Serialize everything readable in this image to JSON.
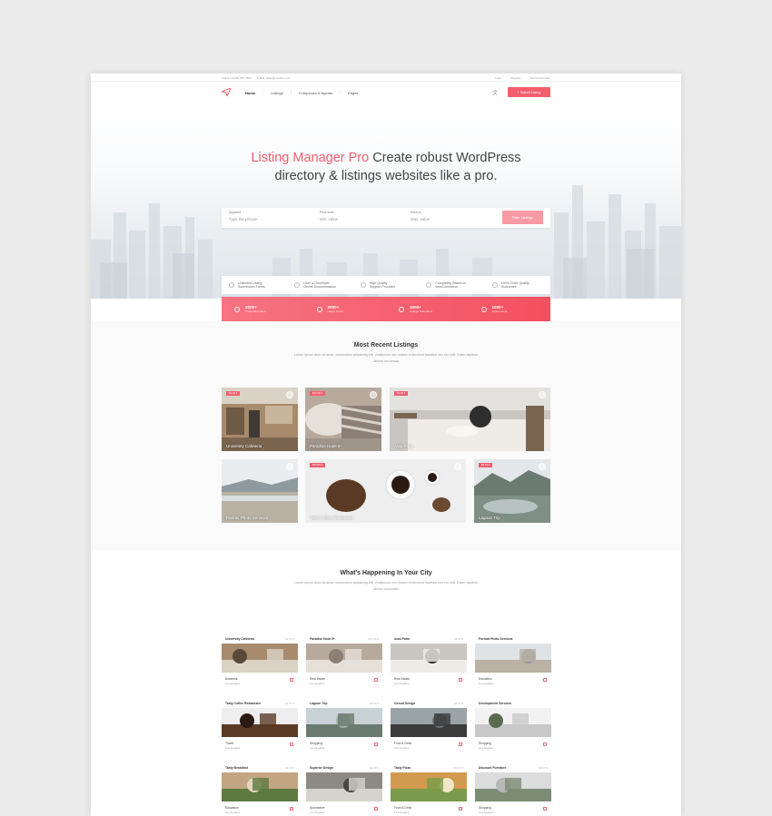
{
  "topbar": {
    "phone": "Call Us 1(123) 456-7890",
    "email": "E-Mail: hello@yoursite.com",
    "links": [
      "Login",
      "Register",
      "Submit Favorites"
    ]
  },
  "nav": {
    "items": [
      "Home",
      "Listings",
      "Companies & Agents",
      "Pages"
    ],
    "submit": "+ Submit Listing"
  },
  "hero": {
    "accent": "Listing Manager Pro",
    "line1_rest": " Create robust WordPress",
    "line2": "directory & listings websites like a pro."
  },
  "search": {
    "f1_label": "Keyword",
    "f1_placeholder": "Type the phrase",
    "f2_label": "Price from",
    "f2_placeholder": "Min. value",
    "f3_label": "Price to",
    "f3_placeholder": "Max. value",
    "button": "Filter Listings"
  },
  "features": [
    {
      "icon": "infinity-icon",
      "l1": "Unlimited Listing",
      "l2": "Submission Forms"
    },
    {
      "icon": "user-icon",
      "l1": "User & Developer",
      "l2": "Online Documentation"
    },
    {
      "icon": "support-icon",
      "l1": "High Quality",
      "l2": "Support Provided"
    },
    {
      "icon": "cart-icon",
      "l1": "Completely Based on",
      "l2": "WooCommerce"
    },
    {
      "icon": "code-icon",
      "l1": "100% Code Quality",
      "l2": "Guarantee"
    }
  ],
  "stats": [
    {
      "num": "2000+",
      "label": "Properties Listed"
    },
    {
      "num": "2000+",
      "label": "Happy Users"
    },
    {
      "num": "3000+",
      "label": "Listings Submitted"
    },
    {
      "num": "1000+",
      "label": "Active Users"
    }
  ],
  "recent": {
    "title": "Most Recent Listings",
    "text": "Lorem ipsum dolor sit amet, consectetur adipiscing elit. Vestibulum nec massa ut tincidunt faucibus nec est velit. Etiam dapibus ultrices accumsan",
    "cards": [
      {
        "title": "University Cafeteria",
        "badge": "$9.99 $"
      },
      {
        "title": "Paradise Hotel 5*",
        "badge": "$19.99 $"
      },
      {
        "title": "Auto Parts",
        "badge": "$9.99 $"
      },
      {
        "title": "Portrait Photo Services",
        "badge": ""
      },
      {
        "title": "Tasty Coffee Restaurant",
        "badge": "$29.99 $"
      },
      {
        "title": "Lagoon Trip",
        "badge": "$9.99 $"
      }
    ]
  },
  "happening": {
    "title": "What's Happening In Your City",
    "text": "Lorem ipsum dolor sit amet, consectetur adipiscing elit. Vestibulum nec massa ut tincidunt faucibus nec est velit. Etiam dapibus ultrices accumsan",
    "items": [
      {
        "name": "University Cafeteria",
        "price": "$9.99 $",
        "cat": "Business",
        "loc": "Los Angeles"
      },
      {
        "name": "Paradise Hotel 5*",
        "price": "$19.99 $",
        "cat": "Real Estate",
        "loc": "Los Angeles"
      },
      {
        "name": "Auto Parts",
        "price": "$9.99 $",
        "cat": "Real Estate",
        "loc": "Los Angeles"
      },
      {
        "name": "Portrait Photo Services",
        "price": "",
        "cat": "Education",
        "loc": "Los Angeles"
      },
      {
        "name": "Tasty Coffee Restaurant",
        "price": "$9.99 $",
        "cat": "Travel",
        "loc": "Los Angeles"
      },
      {
        "name": "Lagoon Trip",
        "price": "$9.99 $",
        "cat": "Shopping",
        "loc": "Los Angeles"
      },
      {
        "name": "Circuit Design",
        "price": "$9.99 $",
        "cat": "Food & Drink",
        "loc": "Los Angeles"
      },
      {
        "name": "Development Services",
        "price": "",
        "cat": "Shopping",
        "loc": "Los Angeles"
      },
      {
        "name": "Tasty Breakfast",
        "price": "$9.99 $",
        "cat": "Education",
        "loc": "Los Angeles"
      },
      {
        "name": "Superior Design",
        "price": "$9.99 $",
        "cat": "Automotive",
        "loc": "Los Angeles"
      },
      {
        "name": "Tasty Pizza",
        "price": "$9.99 $",
        "cat": "Food & Drink",
        "loc": "Los Angeles"
      },
      {
        "name": "Discount Furniture",
        "price": "$9.99 $",
        "cat": "Shopping",
        "loc": "Los Angeles"
      }
    ]
  },
  "colors": {
    "accent": "#f45d6d",
    "page_bg": "#ececec"
  }
}
